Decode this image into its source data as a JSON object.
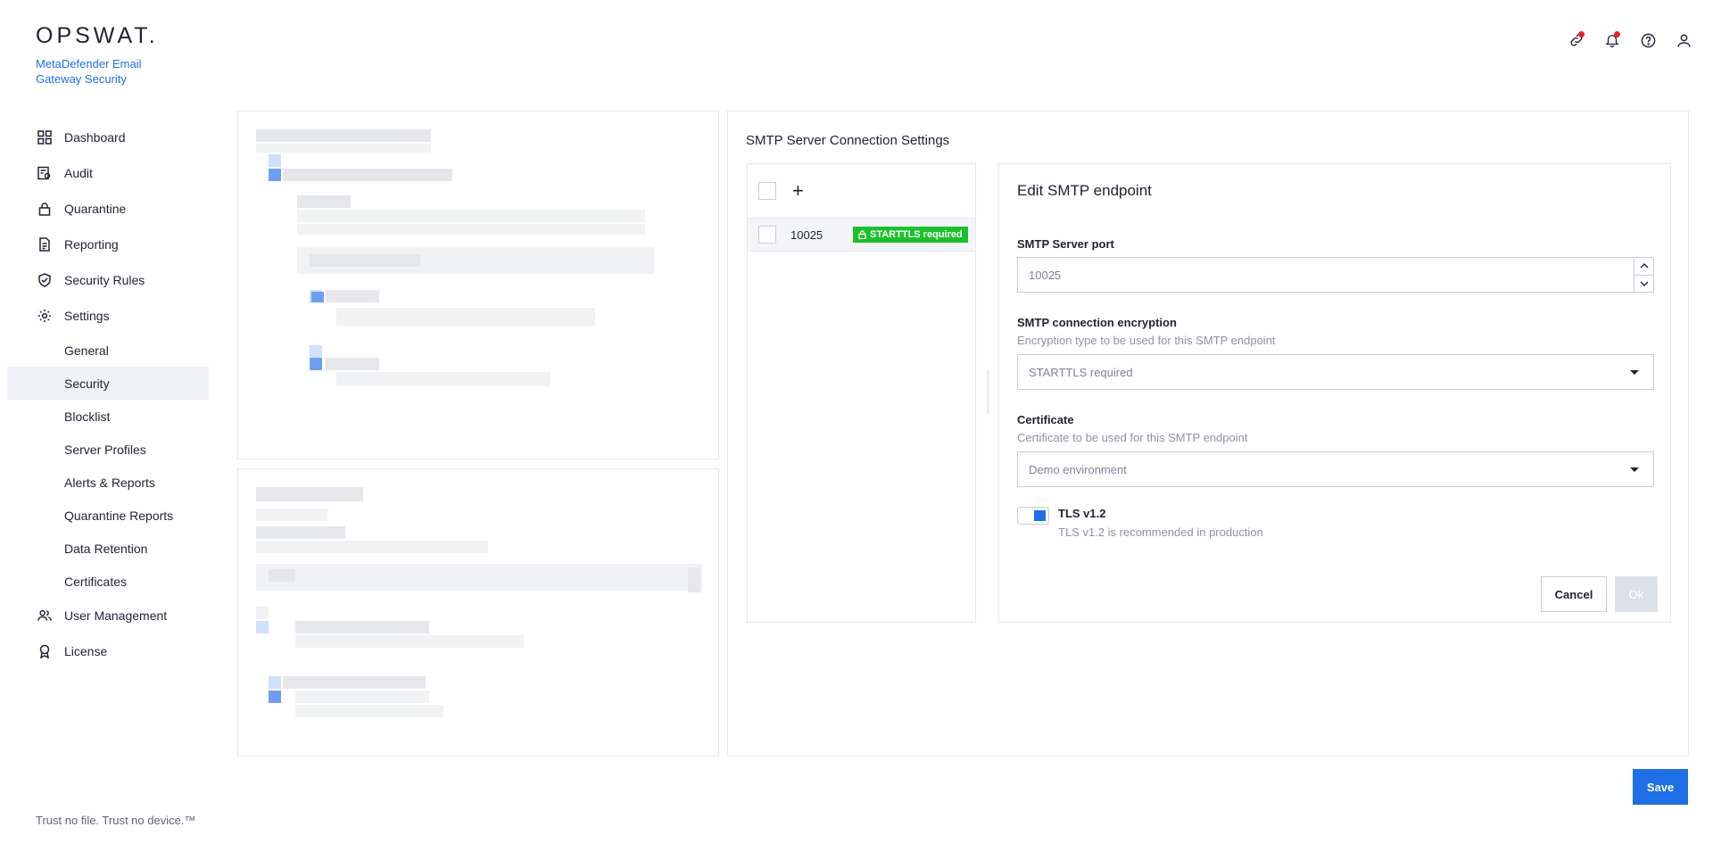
{
  "brand": {
    "logo": "OPSWAT.",
    "product": "MetaDefender Email Gateway Security"
  },
  "header_icons": [
    "link-icon",
    "bell-icon",
    "help-icon",
    "user-icon"
  ],
  "sidebar": {
    "items": [
      {
        "label": "Dashboard",
        "icon": "dashboard-icon"
      },
      {
        "label": "Audit",
        "icon": "audit-icon"
      },
      {
        "label": "Quarantine",
        "icon": "lock-icon"
      },
      {
        "label": "Reporting",
        "icon": "document-icon"
      },
      {
        "label": "Security Rules",
        "icon": "shield-check-icon"
      },
      {
        "label": "Settings",
        "icon": "gear-icon"
      }
    ],
    "settings_sub": [
      "General",
      "Security",
      "Blocklist",
      "Server Profiles",
      "Alerts & Reports",
      "Quarantine Reports",
      "Data Retention",
      "Certificates"
    ],
    "bottom_items": [
      {
        "label": "User Management",
        "icon": "users-icon"
      },
      {
        "label": "License",
        "icon": "award-icon"
      }
    ],
    "active_sub": "Security"
  },
  "footer": {
    "tagline": "Trust no file. Trust no device.™"
  },
  "main": {
    "title": "SMTP Server Connection Settings",
    "list": {
      "rows": [
        {
          "port": "10025",
          "badge": "STARTTLS required"
        }
      ]
    },
    "edit": {
      "title": "Edit SMTP endpoint",
      "port_label": "SMTP Server port",
      "port_value": "10025",
      "enc_label": "SMTP connection encryption",
      "enc_help": "Encryption type to be used for this SMTP endpoint",
      "enc_value": "STARTTLS required",
      "cert_label": "Certificate",
      "cert_help": "Certificate to be used for this SMTP endpoint",
      "cert_value": "Demo environment",
      "tls_label": "TLS v1.2",
      "tls_help": "TLS v1.2 is recommended in production",
      "tls_enabled": true,
      "cancel": "Cancel",
      "ok": "Ok"
    },
    "save": "Save"
  },
  "colors": {
    "accent": "#1f6fe6",
    "badge": "#1cc02c",
    "notify": "#e0242b"
  }
}
